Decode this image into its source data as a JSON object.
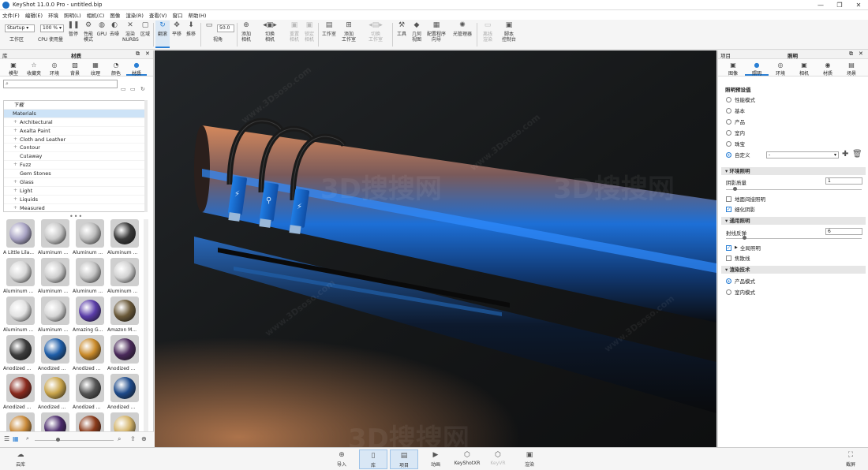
{
  "window": {
    "title": "KeyShot 11.0.0 Pro  -  untitled.bip",
    "controls": [
      "—",
      "❐",
      "✕"
    ]
  },
  "menu": [
    "文件(F)",
    "编辑(E)",
    "环境",
    "照明(L)",
    "相机(C)",
    "图像",
    "渲染(R)",
    "查看(V)",
    "窗口",
    "帮助(H)"
  ],
  "toolbar": {
    "workspace_select": "Startup",
    "workspace_label": "工作区",
    "zoom_select": "100 %",
    "cpu_label": "CPU",
    "usage_label": "使用量",
    "pause_label": "暂停",
    "perf_label": "性能\n模式",
    "gpu_label": "GPU",
    "denoise_label": "去噪",
    "render_nurbs_label": "渲染\nNURBS",
    "region_label": "区域",
    "tumble_label": "翻滚",
    "pan_label": "平移",
    "dolly_label": "推移",
    "fov_value": "50.0",
    "view_label": "视角",
    "add_camera_label": "添加\n相机",
    "switch_camera_label": "切换\n相机",
    "reset_camera_label": "重置\n相机",
    "lock_camera_label": "锁定\n相机",
    "studio_label": "工作室",
    "add_studio_label": "添加\n工作室",
    "switch_studio_label": "切换\n工作室",
    "tools_label": "工具",
    "geometry_view_label": "几何\n视图",
    "config_wizard_label": "配置程序\n向导",
    "light_manager_label": "光管理器",
    "realtime_label": "离线\n渲染",
    "script_label": "脚本\n控制台"
  },
  "library": {
    "panel_title": "库",
    "header": "材质",
    "tabs": [
      "模型",
      "收藏夹",
      "环境",
      "背景",
      "纹理",
      "颜色",
      "材质"
    ],
    "active_tab": "材质",
    "search_placeholder": "",
    "tree": [
      {
        "label": "下载",
        "expand": false,
        "selected": false
      },
      {
        "label": "Materials",
        "expand": false,
        "selected": true
      },
      {
        "label": "Architectural",
        "expand": true,
        "selected": false
      },
      {
        "label": "Axalta Paint",
        "expand": true,
        "selected": false
      },
      {
        "label": "Cloth and Leather",
        "expand": true,
        "selected": false
      },
      {
        "label": "Contour",
        "expand": true,
        "selected": false
      },
      {
        "label": "Cutaway",
        "expand": false,
        "selected": false
      },
      {
        "label": "Fuzz",
        "expand": true,
        "selected": false
      },
      {
        "label": "Gem Stones",
        "expand": false,
        "selected": false
      },
      {
        "label": "Glass",
        "expand": true,
        "selected": false
      },
      {
        "label": "Light",
        "expand": true,
        "selected": false
      },
      {
        "label": "Liquids",
        "expand": true,
        "selected": false
      },
      {
        "label": "Measured",
        "expand": true,
        "selected": false
      }
    ],
    "swatches": [
      {
        "label": "A Little Lila...",
        "color": "#a9a4c4"
      },
      {
        "label": "Aluminum ...",
        "color": "#c9c9c9"
      },
      {
        "label": "Aluminum ...",
        "color": "#bdbdbd"
      },
      {
        "label": "Aluminum ...",
        "color": "#3a3a3a"
      },
      {
        "label": "Aluminum ...",
        "color": "#d8d8d8"
      },
      {
        "label": "Aluminum ...",
        "color": "#cfcfcf"
      },
      {
        "label": "Aluminum ...",
        "color": "#c4c4c4"
      },
      {
        "label": "Aluminum ...",
        "color": "#d2d2d2"
      },
      {
        "label": "Aluminum ...",
        "color": "#e2e2e2"
      },
      {
        "label": "Aluminum ...",
        "color": "#d6d6d6"
      },
      {
        "label": "Amazing G...",
        "color": "#5a3da8"
      },
      {
        "label": "Amazon M...",
        "color": "#6b5a3a"
      },
      {
        "label": "Anodized ...",
        "color": "#3c3c3c"
      },
      {
        "label": "Anodized ...",
        "color": "#1f5ea8"
      },
      {
        "label": "Anodized ...",
        "color": "#c98a2a"
      },
      {
        "label": "Anodized ...",
        "color": "#4a2a5a"
      },
      {
        "label": "Anodized ...",
        "color": "#8a2a1e"
      },
      {
        "label": "Anodized ...",
        "color": "#c9a44a"
      },
      {
        "label": "Anodized ...",
        "color": "#555555"
      },
      {
        "label": "Anodized ...",
        "color": "#1e4a8a"
      },
      {
        "label": "",
        "color": "#c98a3a"
      },
      {
        "label": "",
        "color": "#4a2a6a"
      },
      {
        "label": "",
        "color": "#8a3a1a"
      },
      {
        "label": "",
        "color": "#d4b46a"
      }
    ]
  },
  "project": {
    "panel_title": "项目",
    "header": "照明",
    "tabs": [
      "图像",
      "照明",
      "环境",
      "相机",
      "材质",
      "场景"
    ],
    "active_tab": "照明",
    "presets_title": "照明预设值",
    "presets": [
      {
        "label": "性能模式",
        "on": false
      },
      {
        "label": "基本",
        "on": false
      },
      {
        "label": "产品",
        "on": false
      },
      {
        "label": "室内",
        "on": false
      },
      {
        "label": "珠宝",
        "on": false
      },
      {
        "label": "自定义",
        "on": true
      }
    ],
    "custom_select": "-",
    "env_section": "环境照明",
    "shadow_quality_label": "阴影质量",
    "shadow_quality_value": "1",
    "shadow_quality_level": 0.05,
    "ground_indirect_label": "地面间接照明",
    "ground_indirect_on": false,
    "fine_shadows_label": "细化阴影",
    "fine_shadows_on": true,
    "general_section": "通用照明",
    "ray_bounces_label": "射线反弹",
    "ray_bounces_value": "6",
    "ray_bounces_level": 0.12,
    "global_illum_label": "全局照明",
    "global_illum_on": true,
    "caustics_label": "焦散线",
    "caustics_on": false,
    "tech_section": "渲染技术",
    "tech": [
      {
        "label": "产品模式",
        "on": true
      },
      {
        "label": "室内模式",
        "on": false
      }
    ]
  },
  "bottom": {
    "cloud_label": "云库",
    "import_label": "导入",
    "library_label": "库",
    "project_label": "项目",
    "animation_label": "动画",
    "keyshotxr_label": "KeyShotXR",
    "keyvr_label": "KeyVR",
    "render_label": "渲染",
    "screenshot_label": "截屏"
  },
  "watermark": [
    "3D搜搜网",
    "www.3Dsoso.com"
  ],
  "colors": {
    "accent": "#2a7fd4",
    "cable_blue": "#1e7fe0",
    "copper": "#c87a48"
  }
}
